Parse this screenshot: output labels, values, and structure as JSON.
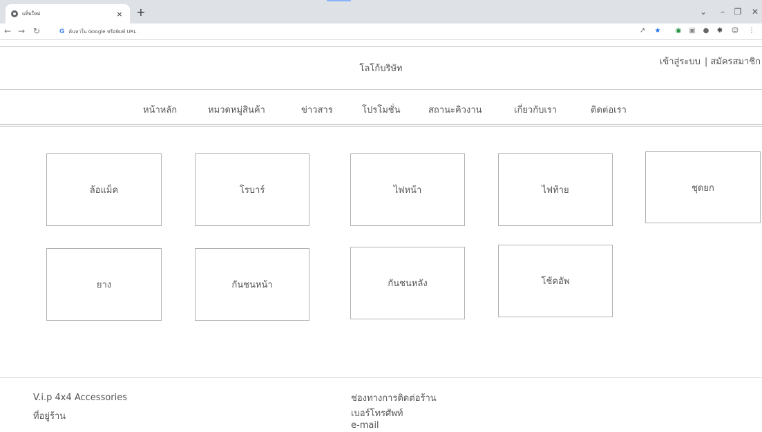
{
  "browser": {
    "tab_title": "แท็บใหม่",
    "tab_close": "×",
    "new_tab": "+",
    "address_placeholder": "ค้นหาใน Google หรือพิมพ์ URL",
    "icons": [
      "back-icon",
      "forward-icon",
      "reload-icon",
      "google-icon",
      "share-icon",
      "bookmark-star-icon",
      "extension-green-icon",
      "extension-pdf-icon",
      "extension-circle-icon",
      "extensions-puzzle-icon",
      "profile-icon",
      "menu-dots-icon",
      "minimize-icon",
      "maximize-icon",
      "close-window-icon",
      "tab-search-icon"
    ]
  },
  "header": {
    "logo": "โลโก้บริษัท",
    "login": "เข้าสู่ระบบ",
    "separator": "|",
    "register": "สมัครสมาชิก"
  },
  "nav": {
    "items": [
      "หน้าหลัก",
      "หมวดหมู่สินค้า",
      "ข่าวสาร",
      "โปรโมชั่น",
      "สถานะคิวงาน",
      "เกี่ยวกับเรา",
      "ติดต่อเรา"
    ]
  },
  "categories": [
    "ล้อแม็ค",
    "โรบาร์",
    "ไฟหน้า",
    "ไฟท้าย",
    "ชุดยก",
    "ยาง",
    "กันชนหน้า",
    "กันชนหลัง",
    "โช้คอัพ"
  ],
  "footer": {
    "shop_name": "V.i.p 4x4 Accessories",
    "address_label": "ที่อยู่ร้าน",
    "contact_heading": "ช่องทางการติดต่อร้าน",
    "phone_label": "เบอร์โทรศัพท์",
    "email_label": "e-mail"
  },
  "colors": {
    "tabstrip": "#dee1e6",
    "border": "#b0b0b0",
    "text": "#555555"
  }
}
